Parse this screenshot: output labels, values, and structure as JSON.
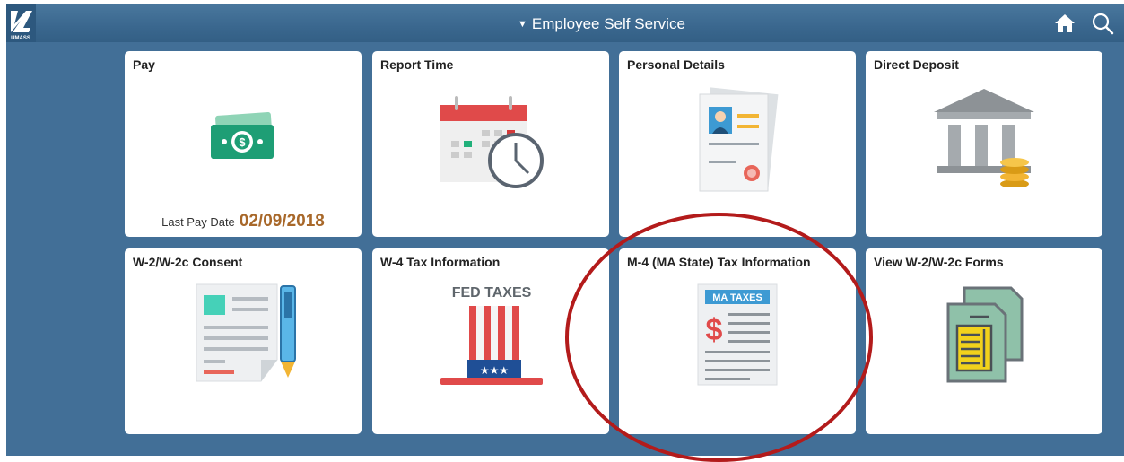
{
  "header": {
    "title": "Employee Self Service",
    "logo_text": "UMASS",
    "icons": [
      "home-icon",
      "search-icon"
    ]
  },
  "tiles": [
    {
      "label": "Pay",
      "icon": "money-icon",
      "footer_label": "Last Pay Date",
      "footer_value": "02/09/2018"
    },
    {
      "label": "Report Time",
      "icon": "calendar-clock-icon"
    },
    {
      "label": "Personal Details",
      "icon": "id-card-document-icon"
    },
    {
      "label": "Direct Deposit",
      "icon": "bank-coins-icon"
    },
    {
      "label": "W-2/W-2c Consent",
      "icon": "document-pen-icon"
    },
    {
      "label": "W-4 Tax Information",
      "icon": "fed-taxes-hat-icon",
      "icon_text": "FED TAXES"
    },
    {
      "label": "M-4 (MA State) Tax Information",
      "icon": "ma-taxes-document-icon",
      "icon_text": "MA TAXES"
    },
    {
      "label": "View W-2/W-2c Forms",
      "icon": "forms-stack-icon"
    }
  ],
  "colors": {
    "header": "#3c6990",
    "background": "#426f97",
    "highlight": "#b31b1b",
    "pay_date": "#a8682a"
  }
}
